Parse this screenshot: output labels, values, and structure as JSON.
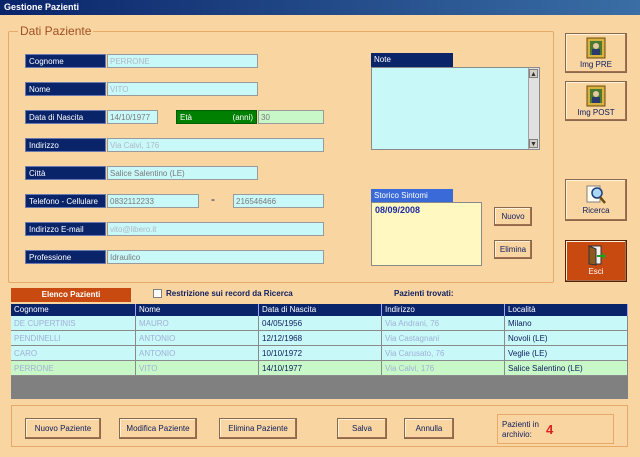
{
  "window": {
    "title": "Gestione Pazienti"
  },
  "dati": {
    "section_title": "Dati Paziente",
    "cognome": {
      "label": "Cognome",
      "value": "PERRONE"
    },
    "nome": {
      "label": "Nome",
      "value": "VITO"
    },
    "data_nascita": {
      "label": "Data di Nascita",
      "value": "14/10/1977"
    },
    "eta": {
      "label": "Età",
      "unit": "(anni)",
      "value": "30"
    },
    "indirizzo": {
      "label": "Indirizzo",
      "value": "Via Calvi, 176"
    },
    "citta": {
      "label": "Città",
      "value": "Salice Salentino (LE)"
    },
    "telefono": {
      "label": "Telefono - Cellulare",
      "value": "0832112233",
      "sep": "-",
      "cellulare": "216546466"
    },
    "email": {
      "label": "Indirizzo E-mail",
      "value": "vito@libero.it"
    },
    "professione": {
      "label": "Professione",
      "value": "Idraulico"
    }
  },
  "note": {
    "label": "Note",
    "value": ""
  },
  "storico": {
    "label": "Storico Sintomi",
    "entries": [
      "08/09/2008"
    ],
    "new_label": "Nuovo",
    "delete_label": "Elimina"
  },
  "side": {
    "img_pre": "Img PRE",
    "img_post": "Img POST",
    "ricerca": "Ricerca",
    "esci": "Esci"
  },
  "elenco": {
    "label": "Elenco Pazienti",
    "restrict_label": "Restrizione sui record da Ricerca",
    "found_label": "Pazienti trovati:",
    "columns": [
      "Cognome",
      "Nome",
      "Data di Nascita",
      "Indirizzo",
      "Località"
    ],
    "rows": [
      [
        "DE CUPERTINIS",
        "MAURO",
        "04/05/1956",
        "Via Andrani, 76",
        "Milano"
      ],
      [
        "PENDINELLI",
        "ANTONIO",
        "12/12/1968",
        "Via Castagnani",
        "Novoli (LE)"
      ],
      [
        "CARO",
        "ANTONIO",
        "10/10/1972",
        "Via Carusato, 76",
        "Veglie (LE)"
      ],
      [
        "PERRONE",
        "VITO",
        "14/10/1977",
        "Via Calvi, 176",
        "Salice Salentino (LE)"
      ]
    ]
  },
  "bottom": {
    "nuovo": "Nuovo Paziente",
    "modifica": "Modifica Paziente",
    "elimina": "Elimina Paziente",
    "salva": "Salva",
    "annulla": "Annulla",
    "archivio_label": "Pazienti in archivio:",
    "archivio_count": "4"
  },
  "colors": {
    "accent": "#c84a10",
    "label_bg": "#0a246a",
    "field_bg": "#c8f8f8",
    "eta_bg": "#008000"
  }
}
